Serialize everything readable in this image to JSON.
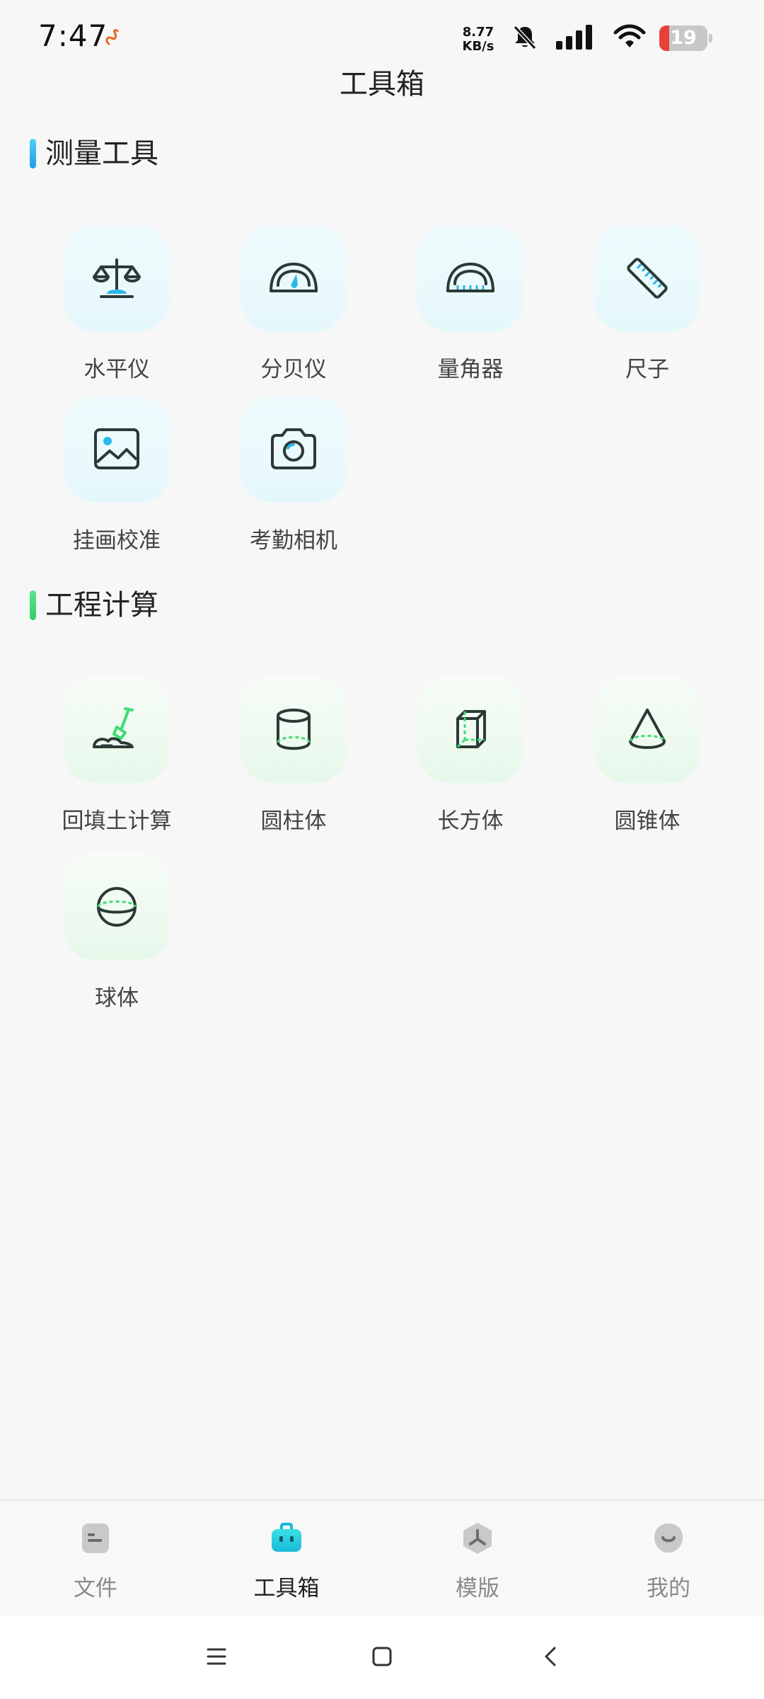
{
  "status_bar": {
    "time": "7:47",
    "net_speed_value": "8.77",
    "net_speed_unit": "KB/s",
    "battery_level": "19",
    "icons": [
      "app-notification-icon",
      "mute-bell-icon",
      "signal-icon",
      "wifi-icon",
      "battery-icon"
    ]
  },
  "header": {
    "title": "工具箱"
  },
  "sections": {
    "measure": {
      "title": "测量工具",
      "accent": "#29b6f6",
      "tools": [
        {
          "label": "水平仪",
          "icon": "level-scale-icon"
        },
        {
          "label": "分贝仪",
          "icon": "decibel-gauge-icon"
        },
        {
          "label": "量角器",
          "icon": "protractor-icon"
        },
        {
          "label": "尺子",
          "icon": "ruler-icon"
        },
        {
          "label": "挂画校准",
          "icon": "picture-frame-icon"
        },
        {
          "label": "考勤相机",
          "icon": "camera-icon"
        }
      ]
    },
    "engineering": {
      "title": "工程计算",
      "accent": "#3ddc74",
      "tools": [
        {
          "label": "回填土计算",
          "icon": "shovel-icon"
        },
        {
          "label": "圆柱体",
          "icon": "cylinder-icon"
        },
        {
          "label": "长方体",
          "icon": "cuboid-icon"
        },
        {
          "label": "圆锥体",
          "icon": "cone-icon"
        },
        {
          "label": "球体",
          "icon": "sphere-icon"
        }
      ]
    }
  },
  "bottom_nav": {
    "items": [
      {
        "label": "文件",
        "icon": "file-icon",
        "active": false
      },
      {
        "label": "工具箱",
        "icon": "toolbox-icon",
        "active": true
      },
      {
        "label": "模版",
        "icon": "template-icon",
        "active": false
      },
      {
        "label": "我的",
        "icon": "profile-icon",
        "active": false
      }
    ]
  },
  "system_nav": {
    "buttons": [
      "menu-icon",
      "home-icon",
      "back-icon"
    ]
  },
  "colors": {
    "icon_stroke": "#2b3a36",
    "blue_accent": "#2bb8e8",
    "green_accent": "#3ddc74",
    "active_nav": "#22d3e0"
  }
}
